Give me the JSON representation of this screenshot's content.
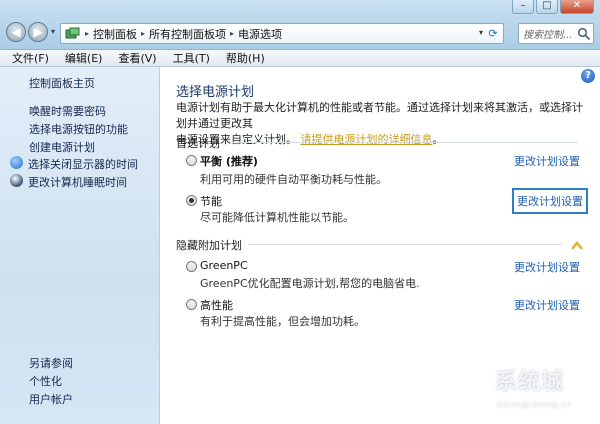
{
  "window": {
    "controls": {
      "minimize": "–",
      "maximize": "□",
      "close": "✕"
    }
  },
  "nav": {
    "back_glyph": "◀",
    "forward_glyph": "▶",
    "dropdown_glyph": "▾"
  },
  "address": {
    "icon": "control-panel-icon",
    "breadcrumbs": [
      "控制面板",
      "所有控制面板项",
      "电源选项"
    ],
    "separator": "▸",
    "dropdown_glyph": "▾",
    "refresh_glyph": "⟳"
  },
  "search": {
    "placeholder": "搜索控制..."
  },
  "menubar": {
    "items": [
      "文件(F)",
      "编辑(E)",
      "查看(V)",
      "工具(T)",
      "帮助(H)"
    ]
  },
  "sidebar": {
    "home": "控制面板主页",
    "links": [
      "唤醒时需要密码",
      "选择电源按钮的功能",
      "创建电源计划",
      "选择关闭显示器的时间",
      "更改计算机睡眠时间"
    ],
    "see_also_label": "另请参阅",
    "see_also": [
      "个性化",
      "用户帐户"
    ]
  },
  "main": {
    "help_glyph": "?",
    "title": "选择电源计划",
    "description_line1": "电源计划有助于最大化计算机的性能或者节能。通过选择计划来将其激活，或选择计划并通过更改其",
    "description_line2": "电源设置来自定义计划。",
    "description_link": "请提供电源计划的详细信息",
    "description_end": "。",
    "preferred_label": "首选计划",
    "hidden_label": "隐藏附加计划",
    "plans": [
      {
        "name": "平衡 (推荐)",
        "desc": "利用可用的硬件自动平衡功耗与性能。",
        "link": "更改计划设置",
        "selected": false
      },
      {
        "name": "节能",
        "desc": "尽可能降低计算机性能以节能。",
        "link": "更改计划设置",
        "selected": true
      },
      {
        "name": "GreenPC",
        "desc": "GreenPC优化配置电源计划,帮您的电脑省电.",
        "link": "更改计划设置",
        "selected": false
      },
      {
        "name": "高性能",
        "desc": "有利于提高性能，但会增加功耗。",
        "link": "更改计划设置",
        "selected": false
      }
    ]
  },
  "watermark": {
    "text": "系统城",
    "url": "xitongcheng.cc"
  },
  "colors": {
    "link": "#1f5fb3",
    "title": "#1a3a6a",
    "accent_link": "#c79b19",
    "chevron": "#e0b020"
  }
}
